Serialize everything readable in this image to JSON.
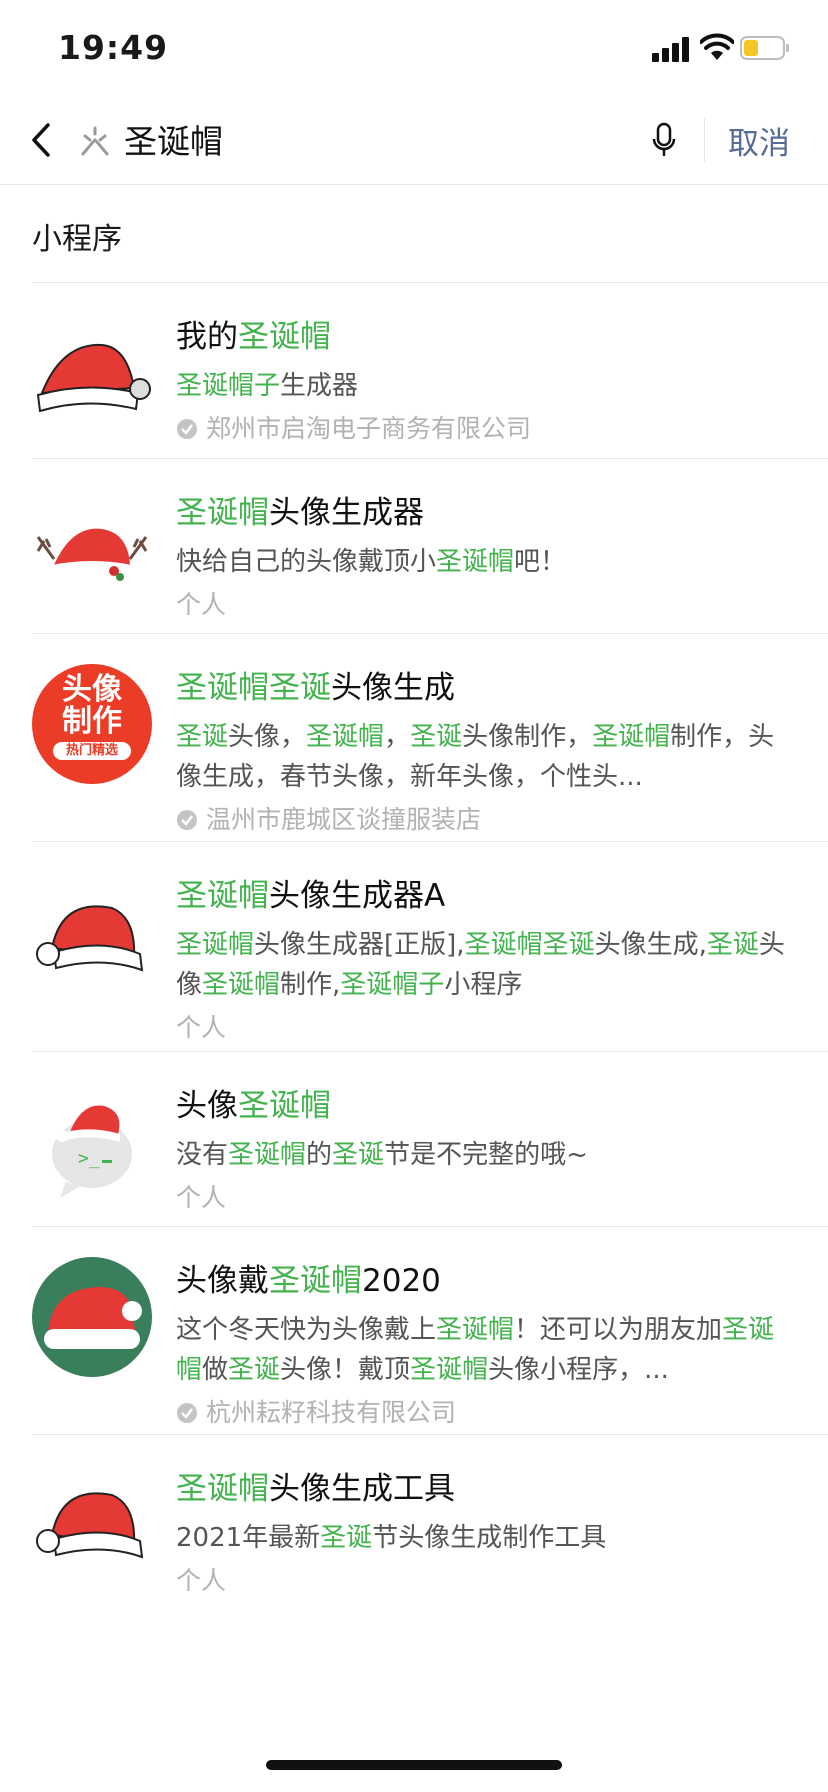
{
  "status_bar": {
    "time": "19:49",
    "battery_color": "#f5c623"
  },
  "search": {
    "query": "圣诞帽",
    "cancel_label": "取消",
    "mini_program_icon": "mini-program-icon"
  },
  "section": {
    "title": "小程序"
  },
  "colors": {
    "highlight": "#43b34e",
    "link": "#576b95"
  },
  "results": [
    {
      "title": [
        [
          "我的",
          0
        ],
        [
          "圣诞帽",
          1
        ]
      ],
      "desc": [
        [
          "圣诞帽子",
          1
        ],
        [
          "生成器",
          0
        ]
      ],
      "source": "郑州市启淘电子商务有限公司",
      "verified": true,
      "icon": "santa-hat-icon"
    },
    {
      "title": [
        [
          "圣诞帽",
          1
        ],
        [
          "头像生成器",
          0
        ]
      ],
      "desc": [
        [
          "快给自己的头像戴顶小",
          0
        ],
        [
          "圣诞帽",
          1
        ],
        [
          "吧！",
          0
        ]
      ],
      "source": "个人",
      "verified": false,
      "icon": "reindeer-santa-hat-icon"
    },
    {
      "title": [
        [
          "圣诞帽",
          1
        ],
        [
          "圣诞",
          1
        ],
        [
          "头像生成",
          0
        ]
      ],
      "desc": [
        [
          "圣诞",
          1
        ],
        [
          "头像，",
          0
        ],
        [
          "圣诞帽",
          1
        ],
        [
          "，",
          0
        ],
        [
          "圣诞",
          1
        ],
        [
          "头像制作，",
          0
        ],
        [
          "圣诞帽",
          1
        ],
        [
          "制作，头像生成，春节头像，新年头像，个性头...",
          0
        ]
      ],
      "source": "温州市鹿城区谈撞服装店",
      "verified": true,
      "icon": "avatar-make-badge-icon",
      "badge": {
        "line1": "头像",
        "line2": "制作",
        "tag": "热门精选"
      }
    },
    {
      "title": [
        [
          "圣诞帽",
          1
        ],
        [
          "头像生成器A",
          0
        ]
      ],
      "desc": [
        [
          "圣诞帽",
          1
        ],
        [
          "头像生成器[正版],",
          0
        ],
        [
          "圣诞帽",
          1
        ],
        [
          "圣诞",
          1
        ],
        [
          "头像生成,",
          0
        ],
        [
          "圣诞",
          1
        ],
        [
          "头像",
          0
        ],
        [
          "圣诞帽",
          1
        ],
        [
          "制作,",
          0
        ],
        [
          "圣诞帽子",
          1
        ],
        [
          "小程序",
          0
        ]
      ],
      "source": "个人",
      "verified": false,
      "icon": "santa-hat-icon"
    },
    {
      "title": [
        [
          "头像",
          0
        ],
        [
          "圣诞帽",
          1
        ]
      ],
      "desc": [
        [
          "没有",
          0
        ],
        [
          "圣诞帽",
          1
        ],
        [
          "的",
          0
        ],
        [
          "圣诞",
          1
        ],
        [
          "节是不完整的哦~",
          0
        ]
      ],
      "source": "个人",
      "verified": false,
      "icon": "chat-bubble-santa-hat-icon"
    },
    {
      "title": [
        [
          "头像戴",
          0
        ],
        [
          "圣诞帽",
          1
        ],
        [
          "2020",
          0
        ]
      ],
      "desc": [
        [
          "这个冬天快为头像戴上",
          0
        ],
        [
          "圣诞帽",
          1
        ],
        [
          "！还可以为朋友加",
          0
        ],
        [
          "圣诞帽",
          1
        ],
        [
          "做",
          0
        ],
        [
          "圣诞",
          1
        ],
        [
          "头像！戴顶",
          0
        ],
        [
          "圣诞帽",
          1
        ],
        [
          "头像小程序，...",
          0
        ]
      ],
      "source": "杭州耘籽科技有限公司",
      "verified": true,
      "icon": "santa-hat-green-circle-icon"
    },
    {
      "title": [
        [
          "圣诞帽",
          1
        ],
        [
          "头像生成工具",
          0
        ]
      ],
      "desc": [
        [
          "2021年最新",
          0
        ],
        [
          "圣诞",
          1
        ],
        [
          "节头像生成制作工具",
          0
        ]
      ],
      "source": "个人",
      "verified": false,
      "icon": "santa-hat-icon"
    }
  ]
}
